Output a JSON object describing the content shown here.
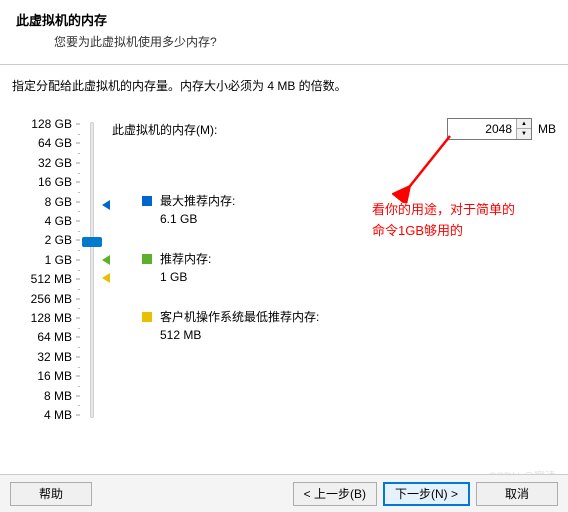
{
  "header": {
    "title": "此虚拟机的内存",
    "subtitle": "您要为此虚拟机使用多少内存?"
  },
  "instruction": "指定分配给此虚拟机的内存量。内存大小必须为 4 MB 的倍数。",
  "memory": {
    "label": "此虚拟机的内存(M):",
    "value": "2048",
    "unit": "MB"
  },
  "ticks": [
    "128 GB",
    "64 GB",
    "32 GB",
    "16 GB",
    "8 GB",
    "4 GB",
    "2 GB",
    "1 GB",
    "512 MB",
    "256 MB",
    "128 MB",
    "64 MB",
    "32 MB",
    "16 MB",
    "8 MB",
    "4 MB"
  ],
  "recommendations": {
    "max": {
      "label": "最大推荐内存:",
      "value": "6.1 GB"
    },
    "rec": {
      "label": "推荐内存:",
      "value": "1 GB"
    },
    "min": {
      "label": "客户机操作系统最低推荐内存:",
      "value": "512 MB"
    }
  },
  "annotation": {
    "line1": "看你的用途，对于简单的",
    "line2": "命令1GB够用的"
  },
  "watermark": "CSDN @寥清",
  "buttons": {
    "help": "帮助",
    "back": "< 上一步(B)",
    "next": "下一步(N) >",
    "cancel": "取消"
  }
}
